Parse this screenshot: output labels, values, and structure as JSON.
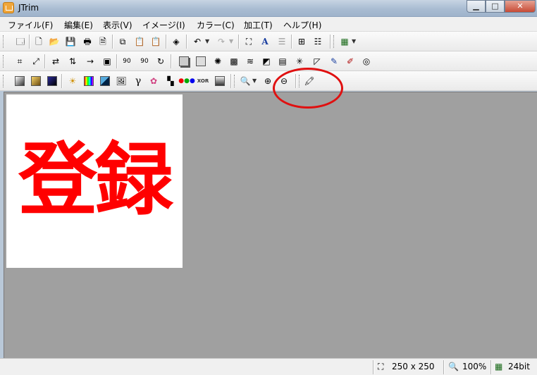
{
  "window": {
    "title": "JTrim"
  },
  "menu": [
    {
      "label": "ファイル(F)"
    },
    {
      "label": "編集(E)"
    },
    {
      "label": "表示(V)"
    },
    {
      "label": "イメージ(I)"
    },
    {
      "label": "カラー(C)"
    },
    {
      "label": "加工(T)"
    },
    {
      "label": "ヘルプ(H)"
    }
  ],
  "toolbar": {
    "row1_icons": [
      "new-window-icon",
      "new-file-icon",
      "open-folder-icon",
      "save-icon",
      "print-icon",
      "print-preview-icon",
      "copy-icon",
      "paste-icon",
      "paste-new-icon",
      "capture-icon",
      "undo-icon",
      "redo-icon",
      "fit-window-icon",
      "text-icon",
      "stamp-icon",
      "tile-icon",
      "strip-icon",
      "grid-select-icon"
    ],
    "row2_icons": [
      "crop-icon",
      "resize-icon",
      "flip-horizontal-icon",
      "flip-vertical-icon",
      "margin-icon",
      "frame-icon",
      "rotate-left-90-icon",
      "rotate-right-90-icon",
      "rotate-free-icon",
      "shadow-icon",
      "border-icon",
      "blur-icon",
      "mosaic-icon",
      "wave-icon",
      "relief-icon",
      "brick-icon",
      "sparkle-icon",
      "perspective-icon",
      "pen-icon",
      "erase-icon",
      "spiral-icon"
    ],
    "row3_icons": [
      "gradient-gray-icon",
      "gradient-gold-icon",
      "gradient-blue-icon",
      "brightness-icon",
      "color-balance-icon",
      "contrast-icon",
      "image-adjust-icon",
      "gamma-icon",
      "hue-icon",
      "checker-icon",
      "rgb-icon",
      "xor-icon",
      "grayscale-icon",
      "zoom-menu-icon",
      "zoom-in-icon",
      "zoom-out-icon",
      "eyedropper-icon"
    ],
    "text_icon_glyph": "A",
    "gamma_glyph": "γ",
    "rotate_left_label": "90",
    "rotate_right_label": "90",
    "xor_label": "XOR"
  },
  "canvas": {
    "text": "登録",
    "text_color": "#ff0000",
    "background": "#ffffff",
    "workspace_color": "#a0a0a0"
  },
  "annotation": {
    "color": "#e01010"
  },
  "status": {
    "image_size": "250 x 250",
    "zoom": "100%",
    "color_depth": "24bit"
  }
}
